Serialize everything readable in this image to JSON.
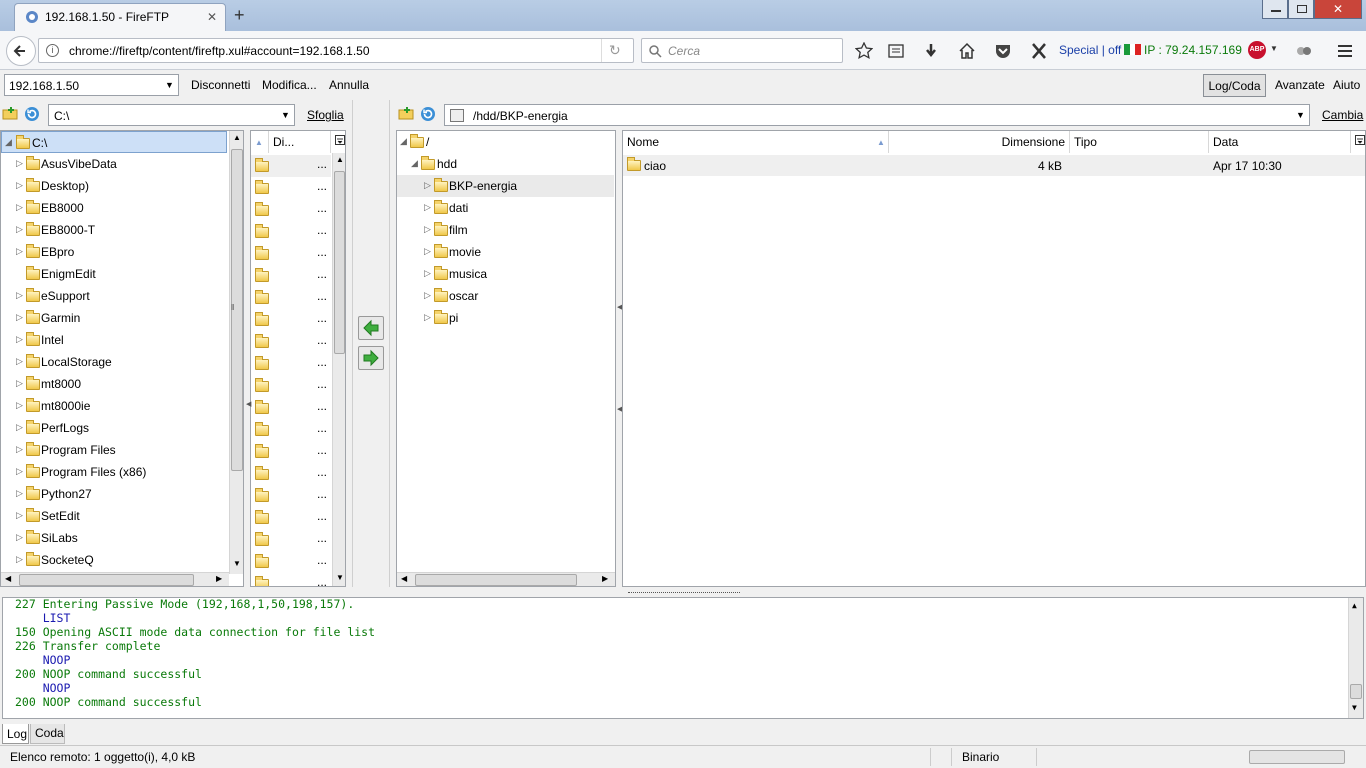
{
  "browser": {
    "tab_title": "192.168.1.50 - FireFTP",
    "url": "chrome://fireftp/content/fireftp.xul#account=192.168.1.50",
    "search_placeholder": "Cerca",
    "special_text": "Special | off",
    "ip_text": "IP : 79.24.157.169"
  },
  "ftp_toolbar": {
    "account": "192.168.1.50",
    "disconnect": "Disconnetti",
    "modify": "Modifica...",
    "cancel": "Annulla",
    "log_queue": "Log/Coda",
    "advanced": "Avanzate",
    "help": "Aiuto"
  },
  "local": {
    "path": "C:\\",
    "browse": "Sfoglia",
    "root": "C:\\",
    "folders": [
      "AsusVibeData",
      "Desktop)",
      "EB8000",
      "EB8000-T",
      "EBpro",
      "EnigmEdit",
      "eSupport",
      "Garmin",
      "Intel",
      "LocalStorage",
      "mt8000",
      "mt8000ie",
      "PerfLogs",
      "Program Files",
      "Program Files (x86)",
      "Python27",
      "SetEdit",
      "SiLabs",
      "SocketeQ"
    ],
    "file_header": "Di...",
    "ellipsis": "..."
  },
  "remote": {
    "path": "/hdd/BKP-energia",
    "change": "Cambia",
    "root": "/",
    "hdd": "hdd",
    "folders": [
      "BKP-energia",
      "dati",
      "film",
      "movie",
      "musica",
      "oscar",
      "pi"
    ],
    "columns": {
      "name": "Nome",
      "size": "Dimensione",
      "type": "Tipo",
      "date": "Data"
    },
    "files": [
      {
        "name": "ciao",
        "size": "4 kB",
        "type": "",
        "date": "Apr 17 10:30"
      }
    ]
  },
  "log": {
    "lines": [
      {
        "text": "227 Entering Passive Mode (192,168,1,50,198,157).",
        "kind": "green"
      },
      {
        "text": "    LIST",
        "kind": "blue"
      },
      {
        "text": "150 Opening ASCII mode data connection for file list",
        "kind": "green"
      },
      {
        "text": "226 Transfer complete",
        "kind": "green"
      },
      {
        "text": "    NOOP",
        "kind": "blue"
      },
      {
        "text": "200 NOOP command successful",
        "kind": "green"
      },
      {
        "text": "    NOOP",
        "kind": "blue"
      },
      {
        "text": "200 NOOP command successful",
        "kind": "green"
      }
    ],
    "tab_log": "Log",
    "tab_queue": "Coda"
  },
  "status": {
    "text": "Elenco remoto: 1 oggetto(i), 4,0 kB",
    "mode": "Binario"
  }
}
